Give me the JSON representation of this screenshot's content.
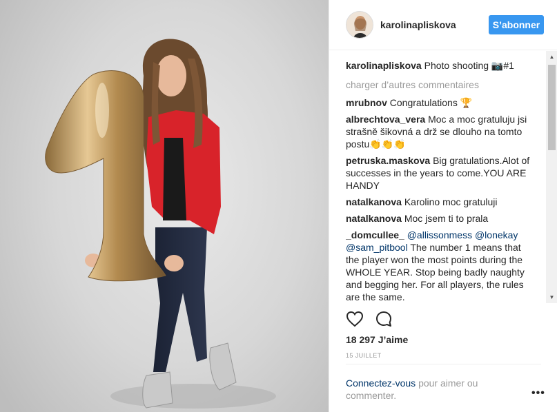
{
  "post": {
    "username": "karolinapliskova",
    "follow_label": "S’abonner",
    "caption_user": "karolinapliskova",
    "caption_text": "Photo shooting 📷#1",
    "load_more": "charger d’autres commentaires",
    "comments": [
      {
        "user": "mrubnov",
        "text": "Congratulations 🏆"
      },
      {
        "user": "albrechtova_vera",
        "text": "Moc a moc gratuluju jsi strašně šikovná a drž se dlouho na tomto postu👏👏👏"
      },
      {
        "user": "petruska.maskova",
        "text": "Big gratulations.Alot of successes in the years to come.YOU ARE HANDY"
      },
      {
        "user": "natalkanova",
        "text": "Karolino moc gratuluji"
      },
      {
        "user": "natalkanova",
        "text": "Moc jsem ti to prala"
      }
    ],
    "last_comment": {
      "user": "_domcullee_",
      "mention1": "@allissonmess",
      "mention2": "@lonekay",
      "mention3": "@sam_pitbool",
      "text": "The number 1 means that the player won the most points during the WHOLE YEAR. Stop being badly naughty and begging her. For all players, the rules are the same."
    },
    "likes": "18 297 J’aime",
    "date": "15 JUILLET",
    "login_link": "Connectez-vous",
    "login_text": "pour aimer ou commenter.",
    "more_label": "•••"
  },
  "icons": {
    "like": "heart-icon",
    "comment": "comment-icon",
    "more": "more-options-icon"
  },
  "colors": {
    "follow_button": "#3897f0",
    "link": "#003569",
    "muted": "#999999"
  }
}
